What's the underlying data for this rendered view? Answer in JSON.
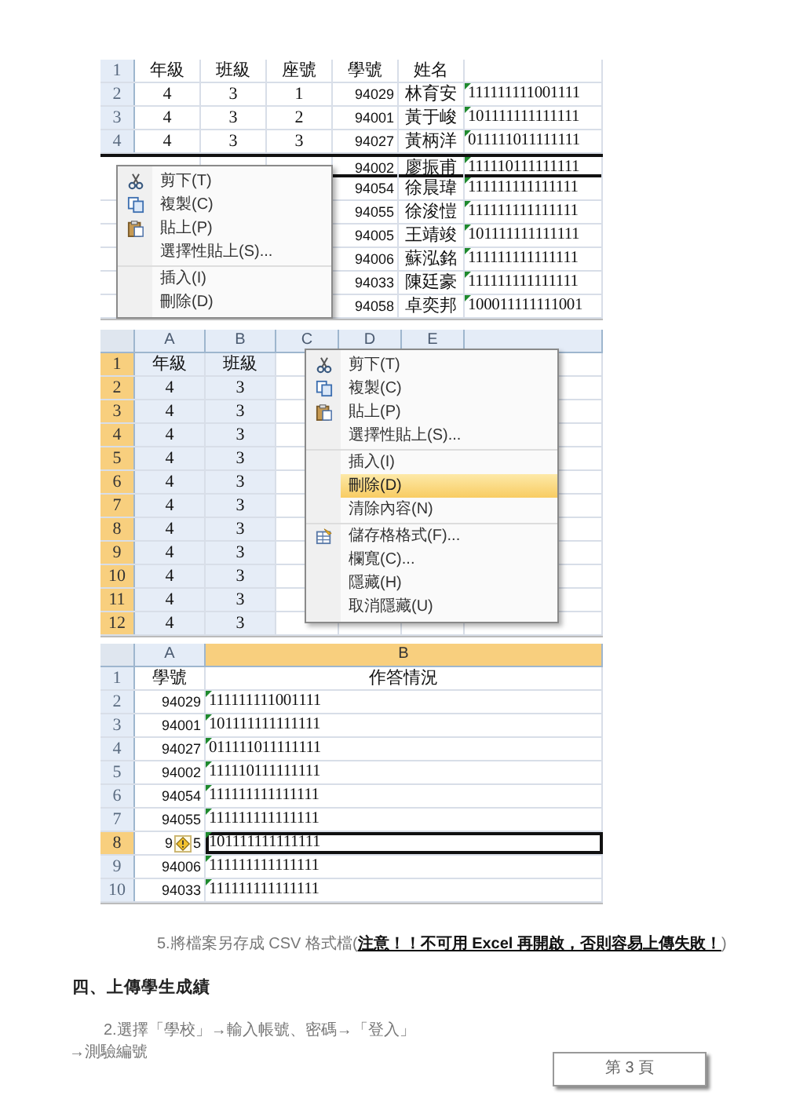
{
  "sheet_1": {
    "rows": [
      {
        "num": "1",
        "grade": "年級",
        "class": "班級",
        "seat": "座號",
        "id": "學號",
        "name": "姓名",
        "selected": false
      },
      {
        "num": "2",
        "grade": "4",
        "class": "3",
        "seat": "1",
        "id": "94029",
        "name": "林育安",
        "answers": "111111111001111",
        "selected": false
      },
      {
        "num": "3",
        "grade": "4",
        "class": "3",
        "seat": "2",
        "id": "94001",
        "name": "黃于峻",
        "answers": "101111111111111",
        "selected": false
      },
      {
        "num": "4",
        "grade": "4",
        "class": "3",
        "seat": "3",
        "id": "94027",
        "name": "黃柄洋",
        "answers": "011111011111111",
        "selected": false
      },
      {
        "id": "94002",
        "name": "廖振甫",
        "answers": "111110111111111",
        "selected": true
      },
      {
        "id": "94054",
        "name": "徐晨瑋",
        "answers": "111111111111111",
        "selected": false
      },
      {
        "id": "94055",
        "name": "徐浚愷",
        "answers": "111111111111111",
        "selected": false
      },
      {
        "id": "94005",
        "name": "王靖竣",
        "answers": "101111111111111",
        "selected": false
      },
      {
        "id": "94006",
        "name": "蘇泓銘",
        "answers": "111111111111111",
        "selected": false
      },
      {
        "id": "94033",
        "name": "陳廷豪",
        "answers": "111111111111111",
        "selected": false
      },
      {
        "id": "94058",
        "name": "卓奕邦",
        "answers": "100011111111001",
        "selected": false
      }
    ],
    "context_menu": [
      {
        "label": "剪下(T)",
        "divider_before": false,
        "selected": false
      },
      {
        "label": "複製(C)",
        "divider_before": false,
        "selected": false
      },
      {
        "label": "貼上(P)",
        "divider_before": false,
        "selected": false
      },
      {
        "label": "選擇性貼上(S)...",
        "divider_before": false,
        "selected": false
      },
      {
        "label": "插入(I)",
        "divider_before": true,
        "selected": false
      },
      {
        "label": "刪除(D)",
        "divider_before": false,
        "selected": false
      }
    ]
  },
  "sheet_2": {
    "columns": [
      "A",
      "B",
      "C",
      "D",
      "E"
    ],
    "rows": [
      {
        "num": "1",
        "selected": true,
        "cells": [
          "年級",
          "班級"
        ]
      },
      {
        "num": "2",
        "selected": true,
        "cells": [
          "4",
          "3"
        ]
      },
      {
        "num": "3",
        "selected": true,
        "cells": [
          "4",
          "3"
        ]
      },
      {
        "num": "4",
        "selected": true,
        "cells": [
          "4",
          "3"
        ]
      },
      {
        "num": "5",
        "selected": true,
        "cells": [
          "4",
          "3"
        ]
      },
      {
        "num": "6",
        "selected": true,
        "cells": [
          "4",
          "3"
        ]
      },
      {
        "num": "7",
        "selected": true,
        "cells": [
          "4",
          "3"
        ]
      },
      {
        "num": "8",
        "selected": true,
        "cells": [
          "4",
          "3"
        ]
      },
      {
        "num": "9",
        "selected": true,
        "cells": [
          "4",
          "3"
        ]
      },
      {
        "num": "10",
        "selected": true,
        "cells": [
          "4",
          "3"
        ]
      },
      {
        "num": "11",
        "selected": true,
        "cells": [
          "4",
          "3"
        ]
      },
      {
        "num": "12",
        "selected": true,
        "cells": [
          "4",
          "3"
        ]
      }
    ],
    "context_menu": [
      {
        "label": "剪下(T)",
        "divider_before": false,
        "selected": false
      },
      {
        "label": "複製(C)",
        "divider_before": false,
        "selected": false
      },
      {
        "label": "貼上(P)",
        "divider_before": false,
        "selected": false
      },
      {
        "label": "選擇性貼上(S)...",
        "divider_before": false,
        "selected": false
      },
      {
        "label": "插入(I)",
        "divider_before": true,
        "selected": false
      },
      {
        "label": "刪除(D)",
        "divider_before": false,
        "selected": true
      },
      {
        "label": "清除內容(N)",
        "divider_before": false,
        "selected": false
      },
      {
        "label": "儲存格格式(F)...",
        "divider_before": true,
        "selected": false
      },
      {
        "label": "欄寬(C)...",
        "divider_before": false,
        "selected": false
      },
      {
        "label": "隱藏(H)",
        "divider_before": false,
        "selected": false
      },
      {
        "label": "取消隱藏(U)",
        "divider_before": false,
        "selected": false
      }
    ]
  },
  "sheet_3": {
    "columns": [
      {
        "label": "A",
        "selected": false
      },
      {
        "label": "B",
        "selected": true
      }
    ],
    "rows": [
      {
        "num": "1",
        "selected": false,
        "kind": "header",
        "id": "學號",
        "answers": "作答情況"
      },
      {
        "num": "2",
        "selected": false,
        "kind": "data",
        "id": "94029",
        "answers": "111111111001111"
      },
      {
        "num": "3",
        "selected": false,
        "kind": "data",
        "id": "94001",
        "answers": "101111111111111"
      },
      {
        "num": "4",
        "selected": false,
        "kind": "data",
        "id": "94027",
        "answers": "011111011111111"
      },
      {
        "num": "5",
        "selected": false,
        "kind": "data",
        "id": "94002",
        "answers": "111110111111111"
      },
      {
        "num": "6",
        "selected": false,
        "kind": "data",
        "id": "94054",
        "answers": "111111111111111"
      },
      {
        "num": "7",
        "selected": false,
        "kind": "data",
        "id": "94055",
        "answers": "111111111111111"
      },
      {
        "num": "8",
        "selected": true,
        "kind": "flagged",
        "id_parts": [
          "9",
          "5"
        ],
        "answers": "101111111111111"
      },
      {
        "num": "9",
        "selected": false,
        "kind": "data",
        "id": "94006",
        "answers": "111111111111111"
      },
      {
        "num": "10",
        "selected": false,
        "kind": "data",
        "id": "94033",
        "answers": "111111111111111"
      }
    ]
  },
  "step_5": "5.將檔案另存成 CSV 格式檔(**注意！！不可用 Excel 再開啟，否則容易上傳失敗！**)",
  "section_heading": "四、上傳學生成績",
  "step_2_lines": [
    "2.選擇「學校」→輸入帳號、密碼→「登入」",
    "→測驗編號"
  ],
  "page_number": "第 3 頁"
}
